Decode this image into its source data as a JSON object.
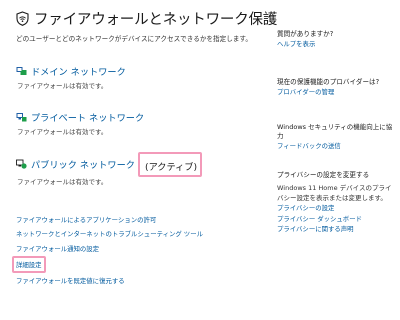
{
  "page": {
    "title": "ファイアウォールとネットワーク保護",
    "subtitle": "どのユーザーとどのネットワークがデバイスにアクセスできるかを指定します。"
  },
  "networks": [
    {
      "name": "ドメイン ネットワーク",
      "status": "ファイアウォールは有効です。",
      "icon": "domain-network-icon"
    },
    {
      "name": "プライベート ネットワーク",
      "status": "ファイアウォールは有効です。",
      "icon": "private-network-icon"
    },
    {
      "name": "パブリック ネットワーク",
      "active_label": "(アクティブ)",
      "status": "ファイアウォールは有効です。",
      "icon": "public-network-icon"
    }
  ],
  "links": [
    "ファイアウォールによるアプリケーションの許可",
    "ネットワークとインターネットのトラブルシューティング ツール",
    "ファイアウォール通知の設定",
    "詳細設定",
    "ファイアウォールを既定値に復元する"
  ],
  "aside": {
    "help": {
      "heading": "質問がありますか?",
      "link": "ヘルプを表示"
    },
    "provider": {
      "heading": "現在の保護機能のプロバイダーは?",
      "link": "プロバイダーの管理"
    },
    "improve": {
      "heading": "Windows セキュリティの機能向上に協力",
      "link": "フィードバックの送信"
    },
    "privacy": {
      "heading": "プライバシーの設定を変更する",
      "text": "Windows 11 Home デバイスのプライバシー設定を表示または変更します。",
      "links": [
        "プライバシーの設定",
        "プライバシー ダッシュボード",
        "プライバシーに関する声明"
      ]
    }
  },
  "colors": {
    "link": "#005a9e",
    "highlight": "#f39ab9",
    "icon_green": "#1e9e4a",
    "icon_blue": "#1f5fa6"
  }
}
